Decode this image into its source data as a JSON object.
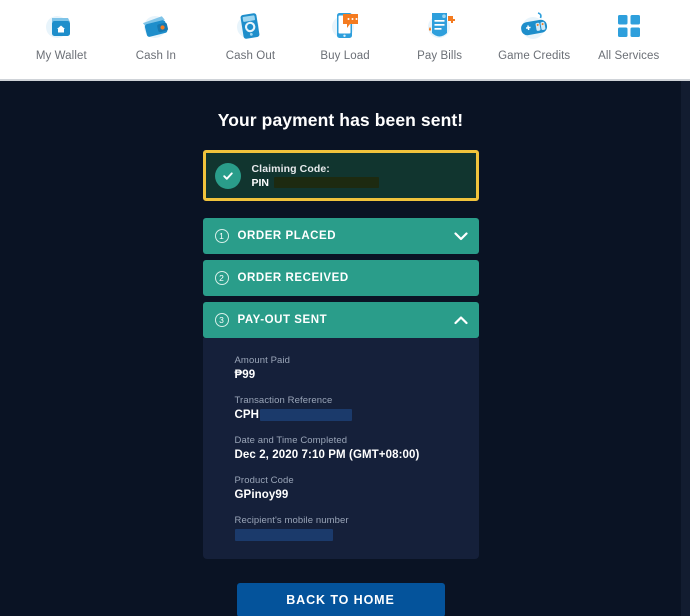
{
  "nav": {
    "items": [
      {
        "label": "My Wallet",
        "icon": "wallet-home-icon"
      },
      {
        "label": "Cash In",
        "icon": "wallet-icon"
      },
      {
        "label": "Cash Out",
        "icon": "atm-machine-icon"
      },
      {
        "label": "Buy Load",
        "icon": "phone-message-icon"
      },
      {
        "label": "Pay Bills",
        "icon": "bill-invoice-icon"
      },
      {
        "label": "Game Credits",
        "icon": "game-controller-icon"
      },
      {
        "label": "All Services",
        "icon": "grid-apps-icon"
      }
    ]
  },
  "main": {
    "title": "Your payment has been sent!",
    "claim": {
      "status_icon": "check-circle-icon",
      "label": "Claiming Code:",
      "pin_label": "PIN",
      "pin_value": ""
    },
    "steps": [
      {
        "number": "1",
        "label": "ORDER PLACED",
        "chevron": "chevron-down-icon",
        "expanded": false
      },
      {
        "number": "2",
        "label": "ORDER RECEIVED",
        "chevron": "",
        "expanded": false
      },
      {
        "number": "3",
        "label": "PAY-OUT SENT",
        "chevron": "chevron-up-icon",
        "expanded": true
      }
    ],
    "details": [
      {
        "label": "Amount Paid",
        "value": "₱99"
      },
      {
        "label": "Transaction Reference",
        "value": "CPH",
        "redacted": true
      },
      {
        "label": "Date and Time Completed",
        "value": "Dec 2, 2020 7:10 PM (GMT+08:00)"
      },
      {
        "label": "Product Code",
        "value": "GPinoy99"
      },
      {
        "label": "Recipient's mobile number",
        "value": "",
        "redacted": true
      }
    ],
    "back_button": "BACK TO HOME"
  },
  "colors": {
    "page_background": "#0a1324",
    "panel_background": "#15203a",
    "accent_teal": "#2a9d8a",
    "accent_gold": "#f0c33c",
    "claim_box_fill": "#11352f",
    "primary_button": "#04539b",
    "nav_background": "#ffffff",
    "nav_label": "#6b6f76",
    "icon_blue": "#2e9fdc",
    "icon_orange": "#f47b20"
  }
}
